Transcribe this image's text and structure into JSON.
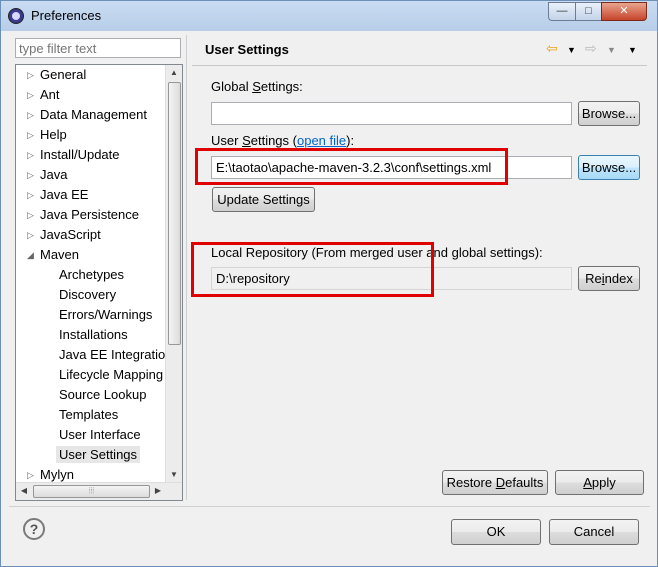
{
  "window": {
    "title": "Preferences",
    "controls": {
      "minimize": "—",
      "maximize": "□",
      "close": "✕"
    }
  },
  "filter": {
    "placeholder": "type filter text"
  },
  "tree": {
    "items": [
      {
        "label": "General",
        "level": 0,
        "expanded": false
      },
      {
        "label": "Ant",
        "level": 0,
        "expanded": false
      },
      {
        "label": "Data Management",
        "level": 0,
        "expanded": false
      },
      {
        "label": "Help",
        "level": 0,
        "expanded": false
      },
      {
        "label": "Install/Update",
        "level": 0,
        "expanded": false
      },
      {
        "label": "Java",
        "level": 0,
        "expanded": false
      },
      {
        "label": "Java EE",
        "level": 0,
        "expanded": false
      },
      {
        "label": "Java Persistence",
        "level": 0,
        "expanded": false
      },
      {
        "label": "JavaScript",
        "level": 0,
        "expanded": false
      },
      {
        "label": "Maven",
        "level": 0,
        "expanded": true
      },
      {
        "label": "Archetypes",
        "level": 1
      },
      {
        "label": "Discovery",
        "level": 1
      },
      {
        "label": "Errors/Warnings",
        "level": 1
      },
      {
        "label": "Installations",
        "level": 1
      },
      {
        "label": "Java EE Integration",
        "level": 1
      },
      {
        "label": "Lifecycle Mapping",
        "level": 1
      },
      {
        "label": "Source Lookup",
        "level": 1
      },
      {
        "label": "Templates",
        "level": 1
      },
      {
        "label": "User Interface",
        "level": 1
      },
      {
        "label": "User Settings",
        "level": 1,
        "selected": true
      },
      {
        "label": "Mylyn",
        "level": 0,
        "expanded": false
      }
    ]
  },
  "page": {
    "title": "User Settings",
    "global_settings_label": {
      "pre": "Global ",
      "key": "S",
      "post": "ettings:"
    },
    "global_settings_value": "",
    "user_settings_label": {
      "pre": "User ",
      "key": "S",
      "post": "ettings (",
      "link": "open file",
      "end": "):"
    },
    "user_settings_value": "E:\\taotao\\apache-maven-3.2.3\\conf\\settings.xml",
    "browse_label": "Browse...",
    "update_settings_label": "Update Settings",
    "local_repo_label": "Local Repository (From merged user and global settings):",
    "local_repo_value": "D:\\repository",
    "reindex_label": {
      "pre": "Re",
      "key": "i",
      "post": "ndex"
    },
    "restore_defaults_label": {
      "pre": "Restore ",
      "key": "D",
      "post": "efaults"
    },
    "apply_label": {
      "key": "A",
      "post": "pply"
    }
  },
  "footer": {
    "ok_label": "OK",
    "cancel_label": "Cancel",
    "help_glyph": "?"
  },
  "colors": {
    "highlight_box": "#e00000",
    "link": "#0066cc",
    "nav_arrow": "#e8a317"
  }
}
